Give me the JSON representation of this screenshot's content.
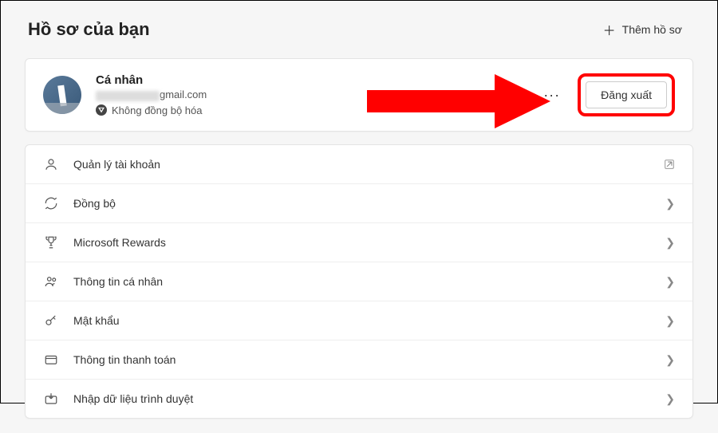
{
  "header": {
    "title": "Hồ sơ của bạn",
    "add_profile_label": "Thêm hồ sơ"
  },
  "profile": {
    "name": "Cá nhân",
    "email_suffix": "gmail.com",
    "sync_status": "Không đồng bộ hóa",
    "more_label": "···",
    "logout_label": "Đăng xuất"
  },
  "menu": [
    {
      "key": "manage-account",
      "label": "Quản lý tài khoản",
      "trailing": "external"
    },
    {
      "key": "sync",
      "label": "Đồng bộ",
      "trailing": "chevron"
    },
    {
      "key": "rewards",
      "label": "Microsoft Rewards",
      "trailing": "chevron"
    },
    {
      "key": "personal-info",
      "label": "Thông tin cá nhân",
      "trailing": "chevron"
    },
    {
      "key": "password",
      "label": "Mật khẩu",
      "trailing": "chevron"
    },
    {
      "key": "payment",
      "label": "Thông tin thanh toán",
      "trailing": "chevron"
    },
    {
      "key": "import",
      "label": "Nhập dữ liệu trình duyệt",
      "trailing": "chevron"
    }
  ]
}
